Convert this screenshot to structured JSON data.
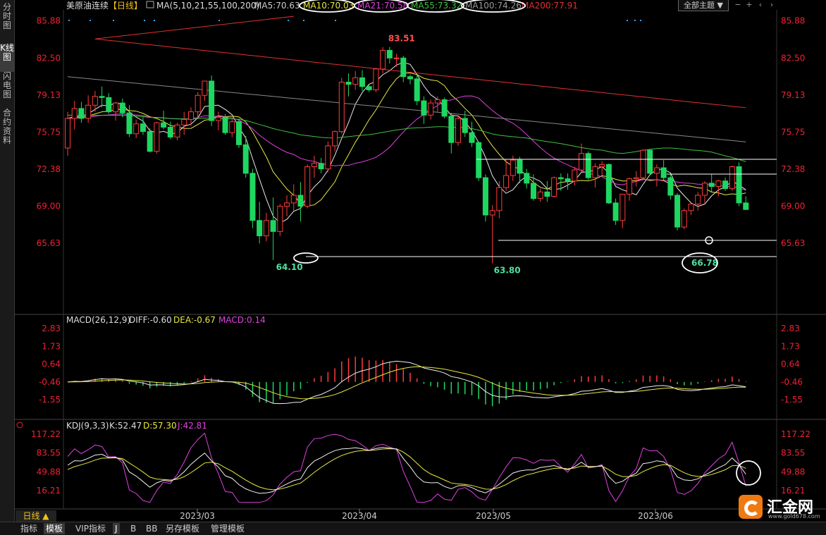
{
  "left_tabs": [
    "分时图",
    "K线图",
    "闪电图",
    "合约资料"
  ],
  "header": {
    "title": "美原油连续",
    "period": "【日线】",
    "ma_label": "MA(5,10,21,55,100,200)",
    "ma_values": [
      {
        "text": "MA5:70.63",
        "color": "#cccccc"
      },
      {
        "text": "MA10:70.03",
        "color": "#e8e840"
      },
      {
        "text": "MA21:70.58",
        "color": "#e040e0"
      },
      {
        "text": "MA55:73.32",
        "color": "#40c040"
      },
      {
        "text": "MA100:74.26",
        "color": "#999999"
      },
      {
        "text": "MA200:77.91",
        "color": "#e03030"
      }
    ],
    "theme_button": "全部主题"
  },
  "price_axis": [
    "85.88",
    "82.50",
    "79.13",
    "75.75",
    "72.38",
    "69.00",
    "65.63"
  ],
  "price_annotations": [
    {
      "text": "83.51",
      "color": "#ff5050"
    },
    {
      "text": "64.10",
      "color": "#50e0a0"
    },
    {
      "text": "63.80",
      "color": "#50e0a0"
    },
    {
      "text": "66.78",
      "color": "#50e0a0"
    }
  ],
  "macd": {
    "label": "MACD(26,12,9)",
    "diff": "DIFF:-0.60",
    "dea": "DEA:-0.67",
    "macd": "MACD:0.14",
    "axis": [
      "2.83",
      "1.73",
      "0.64",
      "-0.46",
      "-1.55"
    ]
  },
  "kdj": {
    "label": "KDJ(9,3,3)",
    "k": "K:52.47",
    "d": "D:57.30",
    "j": "J:42.81",
    "axis": [
      "117.22",
      "83.55",
      "49.88",
      "16.21"
    ]
  },
  "date_labels": [
    "2023/03",
    "2023/04",
    "2023/05",
    "2023/06"
  ],
  "period_label": "日线 ▲",
  "bottom_tabs": [
    "指标",
    "模板",
    "VIP指标",
    "J",
    "B",
    "BB",
    "另存模板",
    "管理模板"
  ],
  "logo": {
    "name": "汇金网",
    "url": "www.gold678.com"
  },
  "colors": {
    "up": "#ff3c3c",
    "down": "#1ed760",
    "background": "#000000"
  },
  "chart_data": {
    "type": "candlestick",
    "title": "美原油连续",
    "period": "日线",
    "ylim": [
      63.0,
      86.5
    ],
    "start_date": "2023-02-08",
    "ohlc": [
      [
        74.3,
        77.6,
        73.6,
        77.0
      ],
      [
        77.0,
        78.6,
        76.0,
        77.9
      ],
      [
        77.9,
        78.5,
        76.6,
        77.0
      ],
      [
        77.0,
        79.1,
        76.6,
        78.2
      ],
      [
        78.2,
        79.5,
        77.6,
        79.0
      ],
      [
        79.0,
        79.9,
        78.0,
        78.9
      ],
      [
        78.9,
        79.3,
        77.4,
        77.6
      ],
      [
        77.6,
        78.5,
        76.8,
        78.4
      ],
      [
        78.4,
        78.8,
        77.1,
        77.5
      ],
      [
        77.5,
        78.2,
        75.3,
        75.6
      ],
      [
        75.6,
        76.9,
        75.2,
        76.5
      ],
      [
        76.5,
        77.1,
        75.5,
        75.8
      ],
      [
        75.8,
        76.1,
        73.9,
        74.0
      ],
      [
        74.0,
        76.7,
        73.8,
        76.6
      ],
      [
        76.6,
        77.7,
        76.0,
        76.2
      ],
      [
        76.2,
        76.7,
        75.1,
        75.3
      ],
      [
        75.3,
        76.6,
        75.0,
        76.4
      ],
      [
        76.4,
        77.6,
        75.5,
        76.9
      ],
      [
        76.9,
        78.0,
        76.3,
        77.6
      ],
      [
        77.6,
        79.4,
        77.1,
        79.1
      ],
      [
        79.1,
        80.2,
        78.6,
        80.4
      ],
      [
        80.4,
        80.9,
        76.3,
        76.8
      ],
      [
        76.8,
        77.6,
        75.9,
        77.1
      ],
      [
        77.1,
        77.4,
        75.5,
        75.7
      ],
      [
        75.7,
        76.9,
        75.3,
        76.7
      ],
      [
        76.7,
        77.0,
        74.3,
        74.6
      ],
      [
        74.6,
        75.4,
        71.6,
        72.0
      ],
      [
        72.0,
        72.4,
        67.0,
        67.7
      ],
      [
        67.7,
        69.4,
        65.6,
        66.3
      ],
      [
        66.3,
        68.4,
        65.8,
        67.7
      ],
      [
        67.7,
        69.8,
        64.1,
        66.7
      ],
      [
        66.7,
        69.2,
        66.3,
        69.0
      ],
      [
        69.0,
        70.0,
        68.1,
        69.3
      ],
      [
        69.3,
        71.0,
        68.6,
        70.0
      ],
      [
        70.0,
        71.2,
        67.6,
        69.0
      ],
      [
        69.0,
        72.8,
        68.8,
        72.6
      ],
      [
        72.6,
        73.6,
        71.6,
        72.9
      ],
      [
        72.9,
        73.4,
        72.0,
        72.4
      ],
      [
        72.4,
        74.9,
        72.1,
        74.5
      ],
      [
        74.5,
        75.9,
        74.0,
        75.8
      ],
      [
        75.8,
        80.7,
        75.6,
        80.3
      ],
      [
        80.3,
        81.1,
        79.0,
        80.1
      ],
      [
        80.1,
        81.3,
        79.6,
        80.7
      ],
      [
        80.7,
        81.4,
        79.5,
        79.9
      ],
      [
        79.9,
        80.1,
        79.4,
        79.6
      ],
      [
        79.6,
        81.6,
        79.4,
        81.5
      ],
      [
        81.5,
        83.5,
        81.1,
        83.2
      ],
      [
        83.2,
        83.5,
        82.0,
        82.5
      ],
      [
        82.5,
        82.9,
        81.7,
        82.5
      ],
      [
        82.5,
        82.7,
        80.3,
        80.8
      ],
      [
        80.8,
        81.0,
        80.1,
        80.6
      ],
      [
        80.6,
        81.0,
        78.2,
        78.6
      ],
      [
        78.6,
        79.0,
        76.5,
        77.3
      ],
      [
        77.3,
        78.7,
        76.9,
        78.4
      ],
      [
        78.4,
        79.0,
        77.6,
        78.7
      ],
      [
        78.7,
        78.9,
        77.0,
        77.2
      ],
      [
        77.2,
        77.5,
        73.8,
        74.8
      ],
      [
        74.8,
        77.3,
        74.5,
        77.0
      ],
      [
        77.0,
        77.7,
        75.3,
        75.7
      ],
      [
        75.7,
        76.7,
        74.4,
        74.8
      ],
      [
        74.8,
        74.9,
        71.3,
        71.6
      ],
      [
        71.6,
        71.9,
        67.6,
        68.2
      ],
      [
        68.2,
        69.1,
        63.8,
        68.6
      ],
      [
        68.6,
        71.3,
        67.9,
        70.7
      ],
      [
        70.7,
        73.3,
        70.4,
        71.8
      ],
      [
        71.8,
        73.6,
        71.3,
        73.2
      ],
      [
        73.2,
        73.5,
        71.1,
        72.0
      ],
      [
        72.0,
        72.4,
        70.6,
        71.1
      ],
      [
        71.1,
        71.9,
        69.5,
        69.7
      ],
      [
        69.7,
        70.6,
        69.4,
        70.3
      ],
      [
        70.3,
        71.3,
        69.4,
        69.9
      ],
      [
        69.9,
        71.7,
        69.8,
        71.6
      ],
      [
        71.6,
        72.0,
        70.4,
        71.5
      ],
      [
        71.5,
        72.0,
        70.5,
        71.3
      ],
      [
        71.3,
        72.6,
        70.9,
        72.3
      ],
      [
        72.3,
        74.7,
        72.1,
        73.8
      ],
      [
        73.8,
        74.0,
        71.4,
        71.6
      ],
      [
        71.6,
        72.9,
        70.7,
        72.6
      ],
      [
        72.6,
        73.1,
        71.8,
        72.8
      ],
      [
        72.8,
        72.9,
        69.2,
        69.3
      ],
      [
        69.3,
        69.7,
        67.3,
        67.7
      ],
      [
        67.7,
        70.0,
        67.0,
        70.1
      ],
      [
        70.1,
        71.6,
        69.5,
        71.5
      ],
      [
        71.5,
        72.2,
        70.8,
        71.6
      ],
      [
        71.6,
        74.2,
        71.4,
        74.1
      ],
      [
        74.1,
        74.2,
        71.8,
        72.0
      ],
      [
        72.0,
        72.8,
        70.8,
        72.5
      ],
      [
        72.5,
        73.2,
        71.3,
        71.6
      ],
      [
        71.6,
        71.9,
        69.6,
        70.0
      ],
      [
        70.0,
        70.2,
        66.8,
        67.1
      ],
      [
        67.1,
        68.8,
        66.9,
        68.6
      ],
      [
        68.6,
        69.4,
        68.2,
        69.2
      ],
      [
        69.2,
        70.3,
        68.6,
        70.0
      ],
      [
        70.0,
        71.3,
        69.3,
        71.1
      ],
      [
        71.1,
        71.9,
        70.3,
        70.8
      ],
      [
        70.8,
        71.4,
        69.9,
        71.3
      ],
      [
        71.3,
        71.6,
        70.4,
        70.6
      ],
      [
        70.6,
        72.7,
        70.4,
        72.6
      ],
      [
        72.6,
        73.0,
        69.0,
        69.3
      ],
      [
        69.3,
        69.9,
        68.7,
        68.7
      ]
    ],
    "ma_periods": [
      5,
      10,
      21,
      55,
      100,
      200
    ],
    "ma_latest": {
      "MA5": 70.63,
      "MA10": 70.03,
      "MA21": 70.58,
      "MA55": 73.32,
      "MA100": 74.26,
      "MA200": 77.91
    },
    "extremes": {
      "high": 83.51,
      "low_mar": 64.1,
      "low_may": 63.8,
      "low_jun": 66.78
    },
    "macd_latest": {
      "DIFF": -0.6,
      "DEA": -0.67,
      "MACD": 0.14
    },
    "kdj_latest": {
      "K": 52.47,
      "D": 57.3,
      "J": 42.81
    },
    "x_ticks": [
      "2023/03",
      "2023/04",
      "2023/05",
      "2023/06"
    ]
  }
}
